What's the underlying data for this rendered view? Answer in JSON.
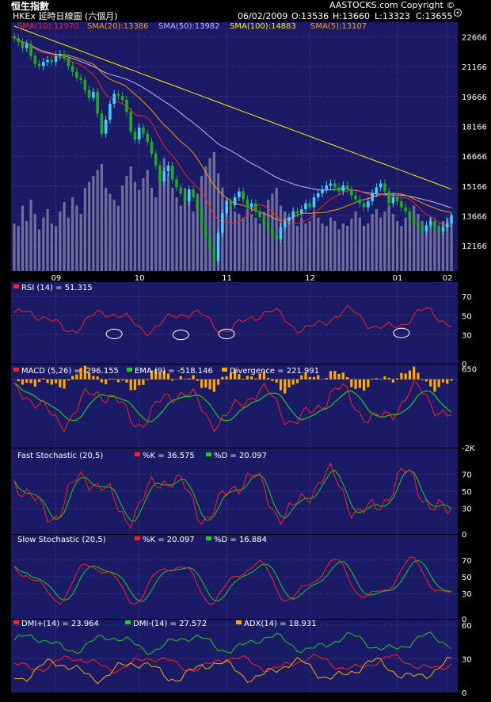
{
  "header": {
    "title": "恒生指數",
    "subtitle": "HKEx 延時日線圖 (六個月)",
    "date": "06/02/2009",
    "open": "O:13536",
    "high": "H:13660",
    "low": "L:13323",
    "close": "C:13655",
    "copyright": "AASTOCKS.com Copyright ©"
  },
  "colors": {
    "panel_bg": "#1a1a66",
    "grid": "#6b6b8f",
    "sma10": "#ff2020",
    "sma20": "#ff9900",
    "sma50": "#bbbbff",
    "sma100": "#ffee00",
    "sma5": "#ff9900",
    "candle_up": "#44ccff",
    "candle_down": "#22aa22",
    "rsi": "#ff2020",
    "macd": "#ff2020",
    "ema": "#22cc22",
    "divergence": "#ffaa00",
    "k": "#ff2020",
    "d": "#22cc22",
    "dmi_plus": "#ff2020",
    "dmi_minus": "#22cc22",
    "adx": "#ffaa00"
  },
  "chart_data": [
    {
      "type": "candlestick",
      "legend": [
        {
          "label": "SMA(10):12970",
          "color": "#ff2020"
        },
        {
          "label": "SMA(20):13386",
          "color": "#ff9900"
        },
        {
          "label": "SMA(50):13982",
          "color": "#bbbbff"
        },
        {
          "label": "SMA(100):14883",
          "color": "#ffee00"
        },
        {
          "label": "SMA(5):13107",
          "color": "#ff9900"
        }
      ],
      "x_ticks": [
        "09",
        "10",
        "11",
        "12",
        "01",
        "02"
      ],
      "y_ticks": [
        22666,
        21166,
        19666,
        18166,
        16666,
        15166,
        13666,
        12166
      ],
      "ylim": [
        10900,
        23400
      ],
      "close": [
        22600,
        22400,
        22100,
        22300,
        21700,
        21300,
        21200,
        21400,
        21500,
        21400,
        21700,
        21800,
        21600,
        21200,
        20900,
        20600,
        20500,
        20000,
        19600,
        19900,
        18800,
        17800,
        18500,
        19300,
        19800,
        19700,
        19500,
        18900,
        17900,
        17500,
        18100,
        17800,
        17400,
        16800,
        16200,
        15400,
        15900,
        16200,
        15500,
        15100,
        14800,
        14400,
        15000,
        14600,
        14000,
        13200,
        12600,
        12000,
        11400,
        12800,
        13800,
        14400,
        14200,
        14600,
        14900,
        14500,
        14100,
        14300,
        13900,
        13600,
        13300,
        13000,
        12700,
        12500,
        13100,
        13400,
        13600,
        13900,
        13800,
        14000,
        14300,
        14100,
        14600,
        14800,
        15000,
        15200,
        15300,
        15100,
        14900,
        15200,
        15000,
        14700,
        14500,
        14300,
        14100,
        14400,
        14800,
        15100,
        15300,
        14900,
        14300,
        14600,
        14400,
        14100,
        13900,
        13500,
        13300,
        13100,
        12900,
        13200,
        13400,
        13100,
        12900,
        13100,
        13300,
        13655
      ],
      "volume": [
        40,
        38,
        55,
        42,
        60,
        48,
        35,
        45,
        52,
        40,
        38,
        50,
        58,
        45,
        62,
        55,
        48,
        70,
        75,
        80,
        85,
        90,
        70,
        65,
        60,
        55,
        72,
        80,
        88,
        75,
        68,
        78,
        85,
        70,
        62,
        80,
        95,
        82,
        70,
        62,
        55,
        70,
        60,
        50,
        65,
        80,
        88,
        95,
        100,
        82,
        70,
        60,
        55,
        50,
        48,
        45,
        52,
        48,
        45,
        40,
        50,
        60,
        65,
        70,
        55,
        50,
        42,
        48,
        38,
        45,
        40,
        42,
        50,
        45,
        40,
        38,
        45,
        42,
        35,
        40,
        38,
        44,
        50,
        45,
        38,
        40,
        48,
        52,
        45,
        50,
        55,
        48,
        42,
        38,
        45,
        50,
        55,
        48,
        42,
        38,
        45,
        40,
        38,
        42,
        45,
        48
      ]
    },
    {
      "type": "line",
      "title": "RSI (14) = 51.315",
      "y_ticks": [
        70,
        50,
        30,
        0
      ],
      "ylim": [
        0,
        85
      ]
    },
    {
      "type": "bar+line",
      "legend": [
        {
          "label": "MACD (5,26) = -296.155",
          "color": "#ff2020"
        },
        {
          "label": "EMA (9) = -518.146",
          "color": "#22cc22"
        },
        {
          "label": "Divergence = 221.991",
          "color": "#ffaa00"
        }
      ],
      "y_ticks": [
        "650",
        "-2K"
      ],
      "ylim": [
        -2000,
        800
      ]
    },
    {
      "type": "line",
      "title": "Fast Stochastic (20,5)",
      "legend": [
        {
          "label": "%K = 36.575",
          "color": "#ff2020"
        },
        {
          "label": "%D = 20.097",
          "color": "#22cc22"
        }
      ],
      "y_ticks": [
        70,
        50,
        30,
        0
      ],
      "ylim": [
        0,
        100
      ]
    },
    {
      "type": "line",
      "title": "Slow Stochastic (20,5)",
      "legend": [
        {
          "label": "%K = 20.097",
          "color": "#ff2020"
        },
        {
          "label": "%D = 16.884",
          "color": "#22cc22"
        }
      ],
      "y_ticks": [
        70,
        50,
        30,
        0
      ],
      "ylim": [
        0,
        100
      ]
    },
    {
      "type": "line",
      "legend": [
        {
          "label": "DMI+(14) = 23.964",
          "color": "#ff2020"
        },
        {
          "label": "DMI-(14) = 27.572",
          "color": "#22cc22"
        },
        {
          "label": "ADX(14) = 18.931",
          "color": "#ffaa00"
        }
      ],
      "y_ticks": [
        60,
        30,
        0
      ],
      "ylim": [
        0,
        65
      ]
    }
  ]
}
